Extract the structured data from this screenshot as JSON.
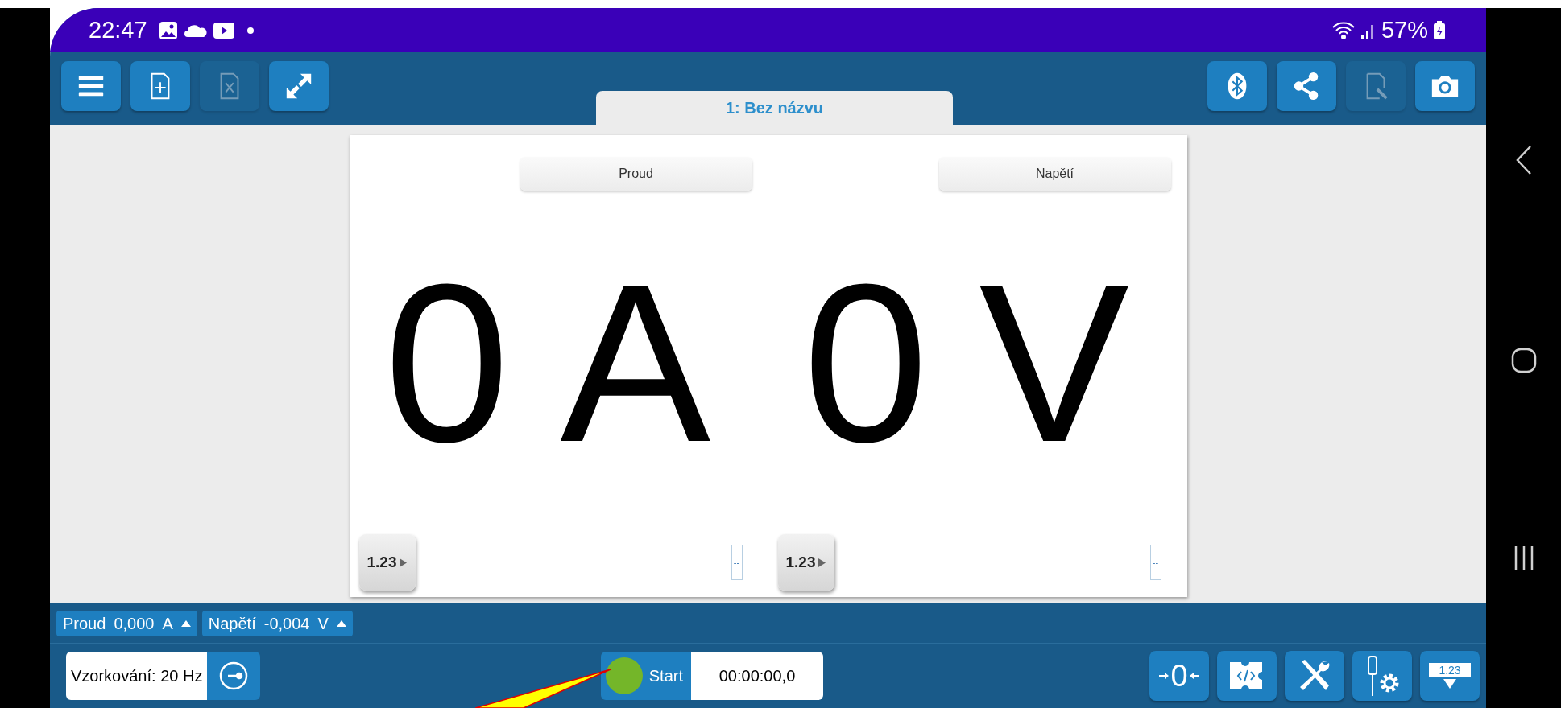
{
  "status_bar": {
    "time": "22:47",
    "battery": "57%"
  },
  "toolbar_left": [
    {
      "kind": "menu",
      "disabled": false
    },
    {
      "kind": "new-file",
      "disabled": false
    },
    {
      "kind": "close-file",
      "disabled": true
    },
    {
      "kind": "expand",
      "disabled": false
    }
  ],
  "toolbar_right": [
    {
      "kind": "bluetooth",
      "disabled": false
    },
    {
      "kind": "share",
      "disabled": false
    },
    {
      "kind": "edit-file",
      "disabled": true
    },
    {
      "kind": "camera",
      "disabled": false
    }
  ],
  "tab": {
    "label": "1: Bez názvu",
    "selected": true
  },
  "meters": [
    {
      "title": "Proud",
      "value": "0",
      "unit": "A",
      "format_button": "1.23",
      "field": "--"
    },
    {
      "title": "Napětí",
      "value": "0",
      "unit": "V",
      "format_button": "1.23",
      "field": "--"
    }
  ],
  "sensors": [
    {
      "name": "Proud",
      "value": "0,000",
      "unit": "A"
    },
    {
      "name": "Napětí",
      "value": "-0,004",
      "unit": "V"
    }
  ],
  "sampling": "Vzorkování: 20 Hz",
  "start": {
    "label": "Start",
    "time": "00:00:00,0"
  },
  "zero_button": "0",
  "display_button": "1.23"
}
